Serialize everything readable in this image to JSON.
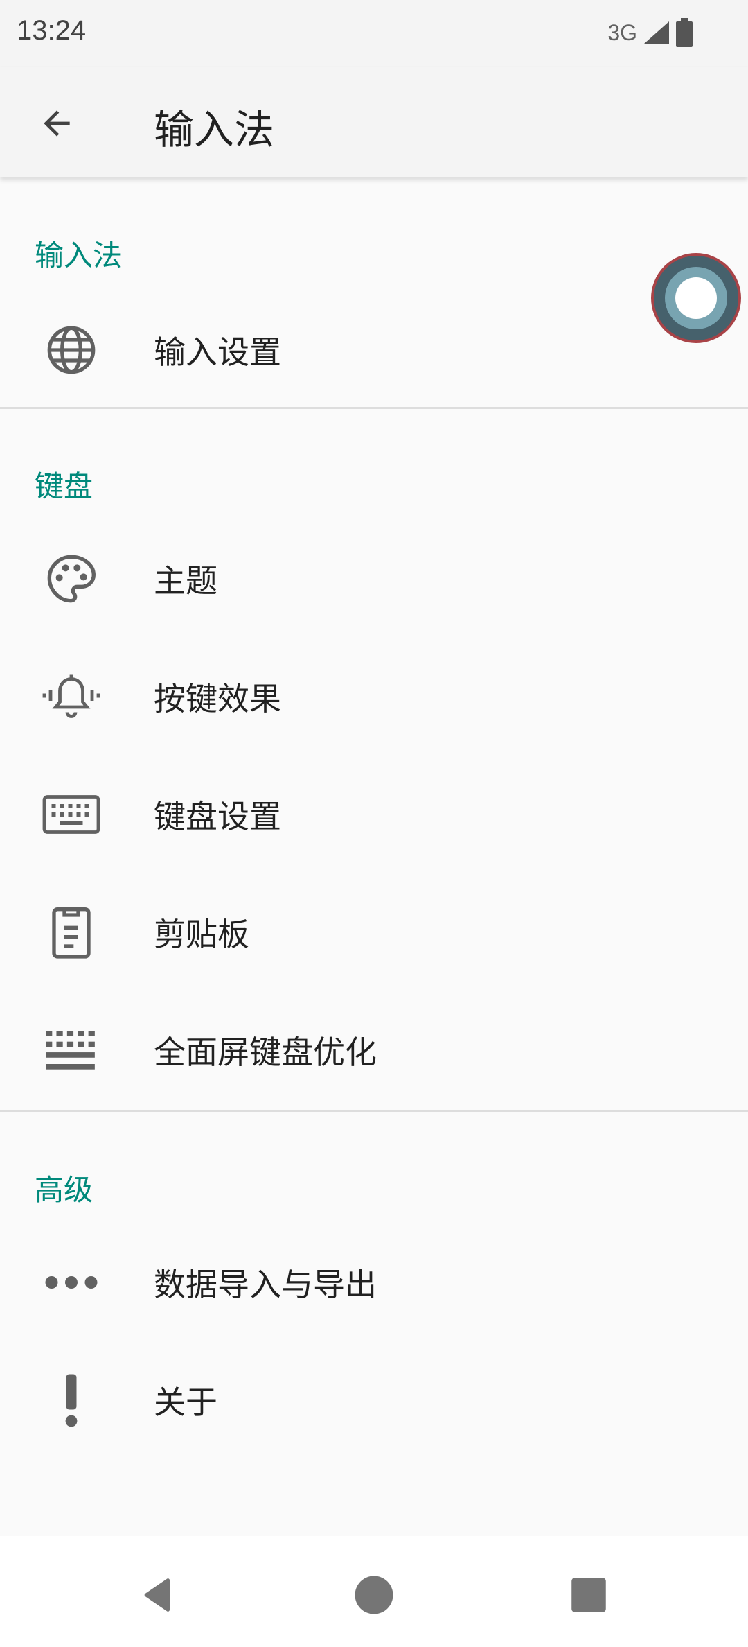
{
  "status_bar": {
    "time": "13:24",
    "network": "3G"
  },
  "app_bar": {
    "title": "输入法"
  },
  "sections": [
    {
      "header": "输入法",
      "items": [
        {
          "label": "输入设置",
          "icon": "globe-icon"
        }
      ]
    },
    {
      "header": "键盘",
      "items": [
        {
          "label": "主题",
          "icon": "palette-icon"
        },
        {
          "label": "按键效果",
          "icon": "vibrating-bell-icon"
        },
        {
          "label": "键盘设置",
          "icon": "keyboard-icon"
        },
        {
          "label": "剪贴板",
          "icon": "clipboard-icon"
        },
        {
          "label": "全面屏键盘优化",
          "icon": "keyboard-optimize-icon"
        }
      ]
    },
    {
      "header": "高级",
      "items": [
        {
          "label": "数据导入与导出",
          "icon": "more-horizontal-icon"
        },
        {
          "label": "关于",
          "icon": "exclamation-icon"
        }
      ]
    }
  ],
  "colors": {
    "accent": "#00897b",
    "background": "#fafafa",
    "bar": "#f4f4f4"
  }
}
